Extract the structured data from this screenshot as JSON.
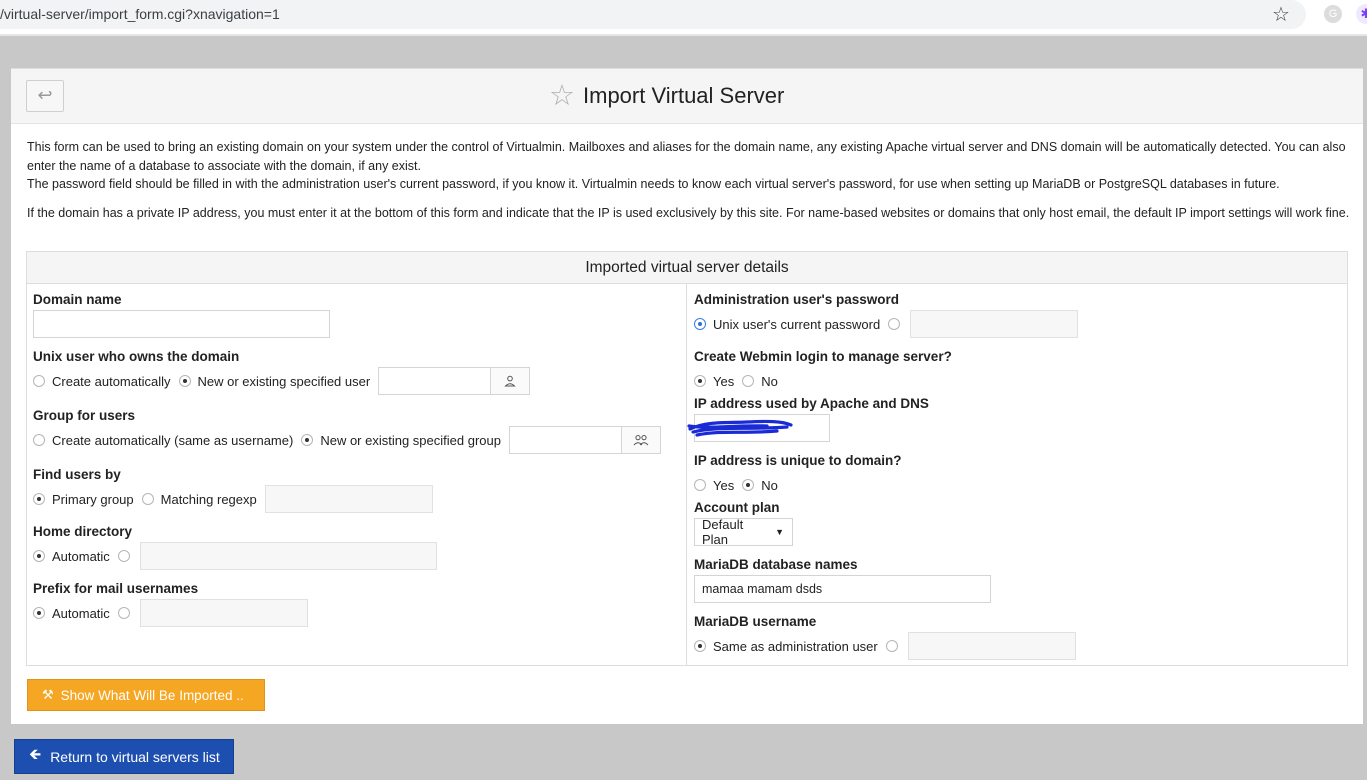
{
  "browser": {
    "url": "/virtual-server/import_form.cgi?xnavigation=1",
    "star_icon": "star-outline-icon"
  },
  "page": {
    "title": "Import Virtual Server",
    "description_1": "This form can be used to bring an existing domain on your system under the control of Virtualmin. Mailboxes and aliases for the domain name, any existing Apache virtual server and DNS domain will be automatically detected. You can also enter the name of a database to associate with the domain, if any exist.",
    "description_2": "The password field should be filled in with the administration user's current password, if you know it. Virtualmin needs to know each virtual server's password, for use when setting up MariaDB or PostgreSQL databases in future.",
    "description_3": "If the domain has a private IP address, you must enter it at the bottom of this form and indicate that the IP is used exclusively by this site. For name-based websites or domains that only host email, the default IP import settings will work fine."
  },
  "form": {
    "section_title": "Imported virtual server details",
    "domain_name": {
      "label": "Domain name",
      "value": ""
    },
    "unix_user": {
      "label": "Unix user who owns the domain",
      "opt_auto": "Create automatically",
      "opt_specified": "New or existing specified user",
      "selected": "specified",
      "value": ""
    },
    "group": {
      "label": "Group for users",
      "opt_auto": "Create automatically (same as username)",
      "opt_specified": "New or existing specified group",
      "selected": "specified",
      "value": ""
    },
    "find_users": {
      "label": "Find users by",
      "opt_primary": "Primary group",
      "opt_regexp": "Matching regexp",
      "selected": "primary",
      "value": ""
    },
    "home_dir": {
      "label": "Home directory",
      "opt_auto": "Automatic",
      "selected": "auto",
      "value": ""
    },
    "mail_prefix": {
      "label": "Prefix for mail usernames",
      "opt_auto": "Automatic",
      "selected": "auto",
      "value": ""
    },
    "admin_password": {
      "label": "Administration user's password",
      "opt_current": "Unix user's current password",
      "selected": "current",
      "value": ""
    },
    "webmin_login": {
      "label": "Create Webmin login to manage server?",
      "opt_yes": "Yes",
      "opt_no": "No",
      "selected": "yes"
    },
    "ip_address": {
      "label": "IP address used by Apache and DNS",
      "value": ""
    },
    "ip_unique": {
      "label": "IP address is unique to domain?",
      "opt_yes": "Yes",
      "opt_no": "No",
      "selected": "no"
    },
    "account_plan": {
      "label": "Account plan",
      "value": "Default Plan"
    },
    "db_names": {
      "label": "MariaDB database names",
      "value": "mamaa mamam dsds"
    },
    "db_username": {
      "label": "MariaDB username",
      "opt_same": "Same as administration user",
      "selected": "same",
      "value": ""
    }
  },
  "buttons": {
    "show_imported": "Show What Will Be Imported ..",
    "return_list": "Return to virtual servers list"
  },
  "colors": {
    "import_button": "#f5a623",
    "return_button": "#1d4fb0",
    "radio_selected_blue": "#2d6fd6",
    "redaction_scribble": "#1a2bd6"
  }
}
